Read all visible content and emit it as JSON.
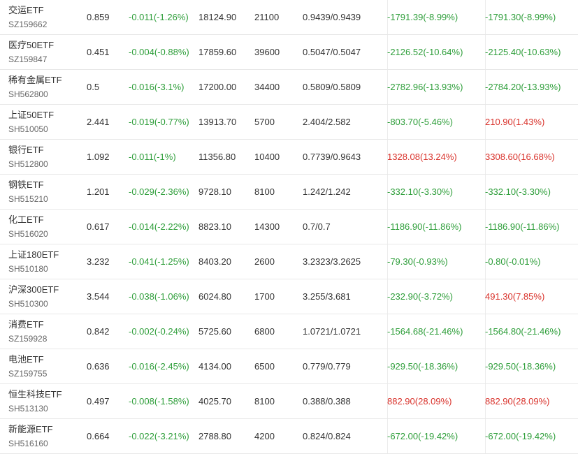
{
  "colors": {
    "down": "#2e9e3a",
    "up": "#d9322b",
    "text": "#333333",
    "subtext": "#666666",
    "border": "#e8e8e8"
  },
  "rows": [
    {
      "name": "交运ETF",
      "code": "SZ159662",
      "price": "0.859",
      "change": "-0.011(-1.26%)",
      "amount": "18124.90",
      "shares": "21100",
      "cost": "0.9439/0.9439",
      "pnl": "-1791.39(-8.99%)",
      "pnl_dir": "down",
      "pnl2": "-1791.30(-8.99%)",
      "pnl2_dir": "down"
    },
    {
      "name": "医疗50ETF",
      "code": "SZ159847",
      "price": "0.451",
      "change": "-0.004(-0.88%)",
      "amount": "17859.60",
      "shares": "39600",
      "cost": "0.5047/0.5047",
      "pnl": "-2126.52(-10.64%)",
      "pnl_dir": "down",
      "pnl2": "-2125.40(-10.63%)",
      "pnl2_dir": "down"
    },
    {
      "name": "稀有金属ETF",
      "code": "SH562800",
      "price": "0.5",
      "change": "-0.016(-3.1%)",
      "amount": "17200.00",
      "shares": "34400",
      "cost": "0.5809/0.5809",
      "pnl": "-2782.96(-13.93%)",
      "pnl_dir": "down",
      "pnl2": "-2784.20(-13.93%)",
      "pnl2_dir": "down"
    },
    {
      "name": "上证50ETF",
      "code": "SH510050",
      "price": "2.441",
      "change": "-0.019(-0.77%)",
      "amount": "13913.70",
      "shares": "5700",
      "cost": "2.404/2.582",
      "pnl": "-803.70(-5.46%)",
      "pnl_dir": "down",
      "pnl2": "210.90(1.43%)",
      "pnl2_dir": "up"
    },
    {
      "name": "银行ETF",
      "code": "SH512800",
      "price": "1.092",
      "change": "-0.011(-1%)",
      "amount": "11356.80",
      "shares": "10400",
      "cost": "0.7739/0.9643",
      "pnl": "1328.08(13.24%)",
      "pnl_dir": "up",
      "pnl2": "3308.60(16.68%)",
      "pnl2_dir": "up"
    },
    {
      "name": "钢铁ETF",
      "code": "SH515210",
      "price": "1.201",
      "change": "-0.029(-2.36%)",
      "amount": "9728.10",
      "shares": "8100",
      "cost": "1.242/1.242",
      "pnl": "-332.10(-3.30%)",
      "pnl_dir": "down",
      "pnl2": "-332.10(-3.30%)",
      "pnl2_dir": "down"
    },
    {
      "name": "化工ETF",
      "code": "SH516020",
      "price": "0.617",
      "change": "-0.014(-2.22%)",
      "amount": "8823.10",
      "shares": "14300",
      "cost": "0.7/0.7",
      "pnl": "-1186.90(-11.86%)",
      "pnl_dir": "down",
      "pnl2": "-1186.90(-11.86%)",
      "pnl2_dir": "down"
    },
    {
      "name": "上证180ETF",
      "code": "SH510180",
      "price": "3.232",
      "change": "-0.041(-1.25%)",
      "amount": "8403.20",
      "shares": "2600",
      "cost": "3.2323/3.2625",
      "pnl": "-79.30(-0.93%)",
      "pnl_dir": "down",
      "pnl2": "-0.80(-0.01%)",
      "pnl2_dir": "down"
    },
    {
      "name": "沪深300ETF",
      "code": "SH510300",
      "price": "3.544",
      "change": "-0.038(-1.06%)",
      "amount": "6024.80",
      "shares": "1700",
      "cost": "3.255/3.681",
      "pnl": "-232.90(-3.72%)",
      "pnl_dir": "down",
      "pnl2": "491.30(7.85%)",
      "pnl2_dir": "up"
    },
    {
      "name": "消费ETF",
      "code": "SZ159928",
      "price": "0.842",
      "change": "-0.002(-0.24%)",
      "amount": "5725.60",
      "shares": "6800",
      "cost": "1.0721/1.0721",
      "pnl": "-1564.68(-21.46%)",
      "pnl_dir": "down",
      "pnl2": "-1564.80(-21.46%)",
      "pnl2_dir": "down"
    },
    {
      "name": "电池ETF",
      "code": "SZ159755",
      "price": "0.636",
      "change": "-0.016(-2.45%)",
      "amount": "4134.00",
      "shares": "6500",
      "cost": "0.779/0.779",
      "pnl": "-929.50(-18.36%)",
      "pnl_dir": "down",
      "pnl2": "-929.50(-18.36%)",
      "pnl2_dir": "down"
    },
    {
      "name": "恒生科技ETF",
      "code": "SH513130",
      "price": "0.497",
      "change": "-0.008(-1.58%)",
      "amount": "4025.70",
      "shares": "8100",
      "cost": "0.388/0.388",
      "pnl": "882.90(28.09%)",
      "pnl_dir": "up",
      "pnl2": "882.90(28.09%)",
      "pnl2_dir": "up"
    },
    {
      "name": "新能源ETF",
      "code": "SH516160",
      "price": "0.664",
      "change": "-0.022(-3.21%)",
      "amount": "2788.80",
      "shares": "4200",
      "cost": "0.824/0.824",
      "pnl": "-672.00(-19.42%)",
      "pnl_dir": "down",
      "pnl2": "-672.00(-19.42%)",
      "pnl2_dir": "down"
    }
  ]
}
